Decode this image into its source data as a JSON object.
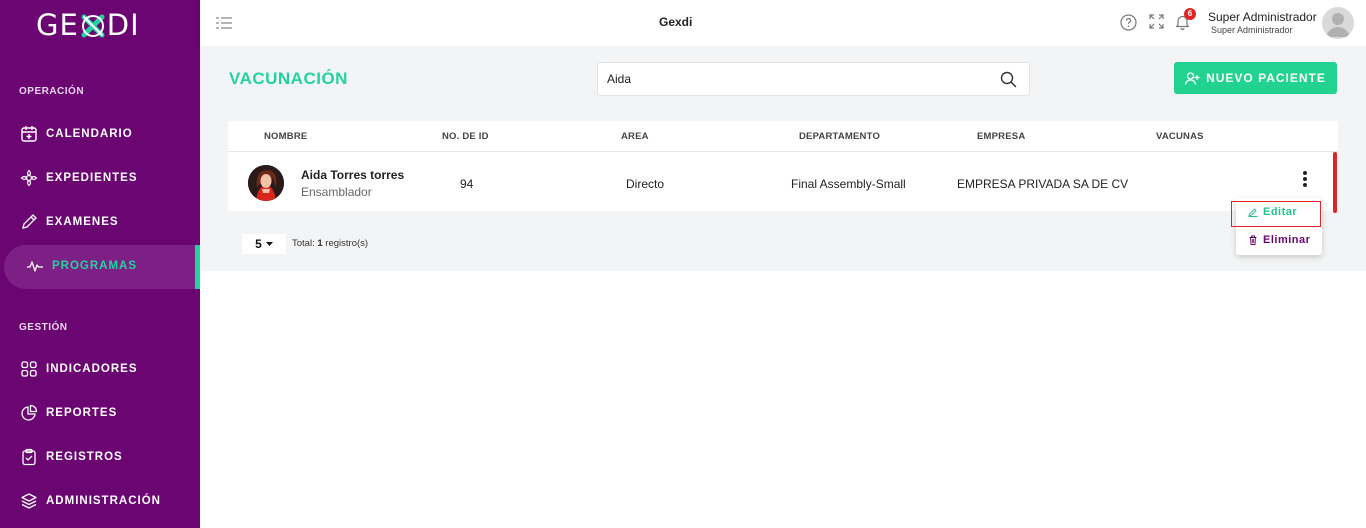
{
  "sidebar": {
    "logo": {
      "left": "GE",
      "right": "DI"
    },
    "section_operacion": "OPERACIÓN",
    "section_gestion": "GESTIÓN",
    "items": [
      {
        "label": "CALENDARIO",
        "icon": "calendar-icon"
      },
      {
        "label": "EXPEDIENTES",
        "icon": "flower-icon"
      },
      {
        "label": "EXAMENES",
        "icon": "pencil-icon"
      },
      {
        "label": "PROGRAMAS",
        "icon": "pulse-icon",
        "active": true
      },
      {
        "label": "INDICADORES",
        "icon": "grid-icon"
      },
      {
        "label": "REPORTES",
        "icon": "pie-chart-icon"
      },
      {
        "label": "REGISTROS",
        "icon": "clipboard-icon"
      },
      {
        "label": "ADMINISTRACIÓN",
        "icon": "layers-icon"
      }
    ]
  },
  "topbar": {
    "app_title": "Gexdi",
    "notification_count": "6",
    "user_name": "Super Administrador",
    "user_role": "Super Administrador"
  },
  "page": {
    "title": "VACUNACIÓN",
    "search_value": "Aida",
    "new_button": "NUEVO PACIENTE"
  },
  "table": {
    "headers": [
      "NOMBRE",
      "NO. DE ID",
      "AREA",
      "DEPARTAMENTO",
      "EMPRESA",
      "VACUNAS"
    ],
    "rows": [
      {
        "name": "Aida Torres torres",
        "role": "Ensamblador",
        "id": "94",
        "area": "Directo",
        "department": "Final Assembly-Small",
        "company": "EMPRESA PRIVADA SA DE CV"
      }
    ]
  },
  "pagination": {
    "page_size": "5",
    "total_prefix": "Total: ",
    "total_count": "1",
    "total_suffix": " registro(s)"
  },
  "context_menu": {
    "edit": "Editar",
    "delete": "Eliminar"
  },
  "colors": {
    "sidebar": "#6a0572",
    "accent": "#22d3a0",
    "danger": "#e02424"
  }
}
